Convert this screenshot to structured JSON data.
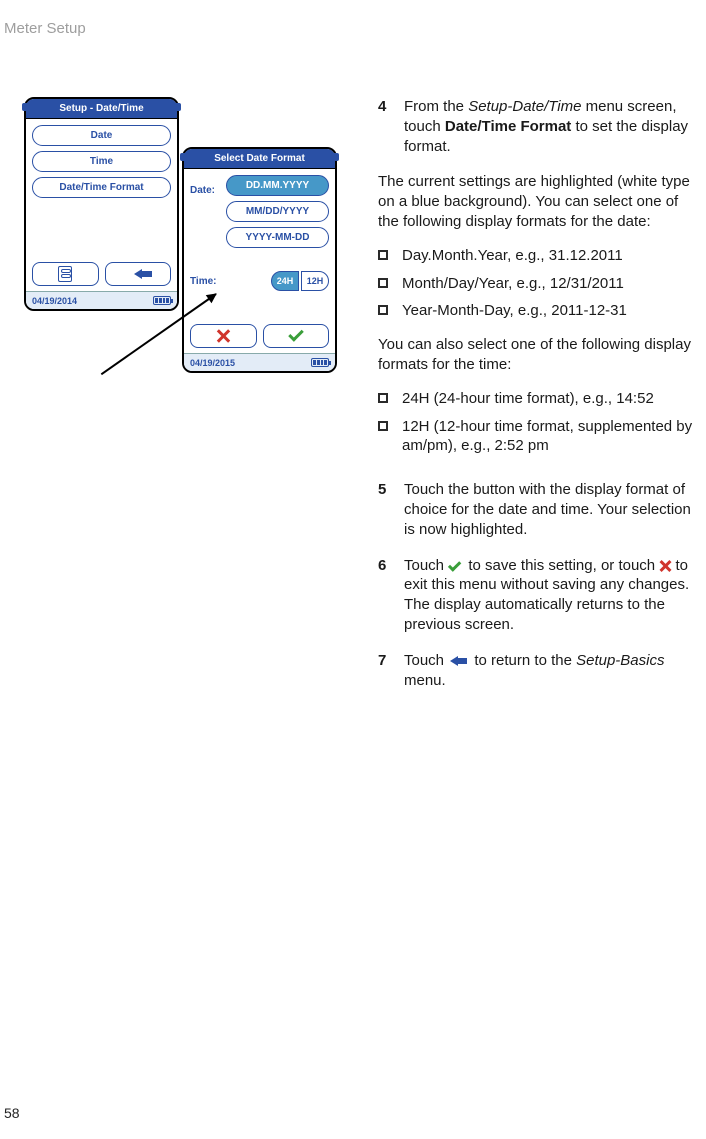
{
  "header": "Meter Setup",
  "pageNumber": "58",
  "device1": {
    "title": "Setup - Date/Time",
    "menu": {
      "date": "Date",
      "time": "Time",
      "format": "Date/Time Format"
    },
    "statusDate": "04/19/2014"
  },
  "device2": {
    "title": "Select Date Format",
    "dateLabel": "Date:",
    "dateOptions": {
      "dmy": "DD.MM.YYYY",
      "mdy": "MM/DD/YYYY",
      "ymd": "YYYY-MM-DD"
    },
    "timeLabel": "Time:",
    "timeOptions": {
      "h24": "24H",
      "h12": "12H"
    },
    "statusDate": "04/19/2015"
  },
  "steps": {
    "s4": {
      "num": "4",
      "t1": "From the ",
      "i1": "Setup-Date/Time",
      "t2": " menu screen, touch ",
      "b1": "Date/Time Format",
      "t3": " to set the display format."
    },
    "p1": "The current settings are highlighted (white type on a blue background). You can select one of the following display formats for the date:",
    "bul": {
      "b1": "Day.Month.Year, e.g., 31.12.2011",
      "b2": "Month/Day/Year, e.g., 12/31/2011",
      "b3": "Year-Month-Day, e.g., 2011-12-31"
    },
    "p2": "You can also select one of the following display formats for the time:",
    "bul2": {
      "b4": "24H (24-hour time format), e.g., 14:52",
      "b5": "12H (12-hour time format, supplemented by am/pm), e.g., 2:52 pm"
    },
    "s5": {
      "num": "5",
      "t": "Touch the button with the display format of choice for the date and time. Your selection is now highlighted."
    },
    "s6": {
      "num": "6",
      "t1": "Touch ",
      "t2": " to save this setting, or touch ",
      "t3": " to exit this menu without saving any changes. The display automatically returns to the previous screen."
    },
    "s7": {
      "num": "7",
      "t1": "Touch ",
      "t2": " to return to the ",
      "i1": "Setup-Basics",
      "t3": " menu."
    }
  }
}
